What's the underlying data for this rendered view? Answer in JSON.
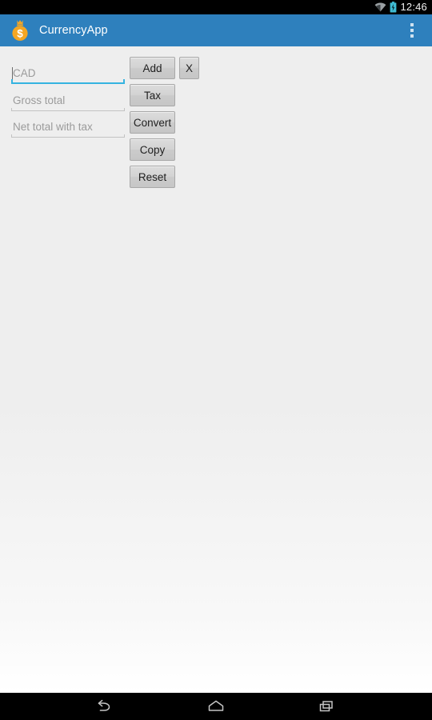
{
  "status_bar": {
    "time": "12:46",
    "icons": [
      {
        "name": "wifi-icon",
        "color": "#9aa0a3"
      },
      {
        "name": "battery-charging-icon",
        "color": "#3fbcd4"
      }
    ]
  },
  "action_bar": {
    "title": "CurrencyApp",
    "background_color": "#2e80bd",
    "title_color": "#ffffff",
    "app_icon": {
      "name": "money-bag-icon",
      "bag_color": "#f5a623",
      "symbol": "$",
      "symbol_color": "#ffffff"
    },
    "overflow_menu": {
      "name": "overflow-menu-icon",
      "label": "More options",
      "dot_count": 3
    }
  },
  "main": {
    "background_color": "#eeeeee",
    "fields": [
      {
        "id": "cad",
        "value": "",
        "placeholder": "CAD",
        "focused": true,
        "underline_color": "#35b3e0"
      },
      {
        "id": "gross",
        "value": "",
        "placeholder": "Gross total",
        "focused": false,
        "underline_color": "#c2c2c2"
      },
      {
        "id": "net",
        "value": "",
        "placeholder": "Net total with tax",
        "focused": false,
        "underline_color": "#c2c2c2"
      }
    ],
    "buttons": [
      {
        "id": "add",
        "label": "Add"
      },
      {
        "id": "x",
        "label": "X"
      },
      {
        "id": "tax",
        "label": "Tax"
      },
      {
        "id": "convert",
        "label": "Convert"
      },
      {
        "id": "copy",
        "label": "Copy"
      },
      {
        "id": "reset",
        "label": "Reset"
      }
    ]
  },
  "nav_bar": {
    "background_color": "#000000",
    "buttons": [
      {
        "id": "back",
        "name": "back-icon",
        "label": "Back"
      },
      {
        "id": "home",
        "name": "home-icon",
        "label": "Home"
      },
      {
        "id": "recents",
        "name": "recents-icon",
        "label": "Recent apps"
      }
    ]
  }
}
